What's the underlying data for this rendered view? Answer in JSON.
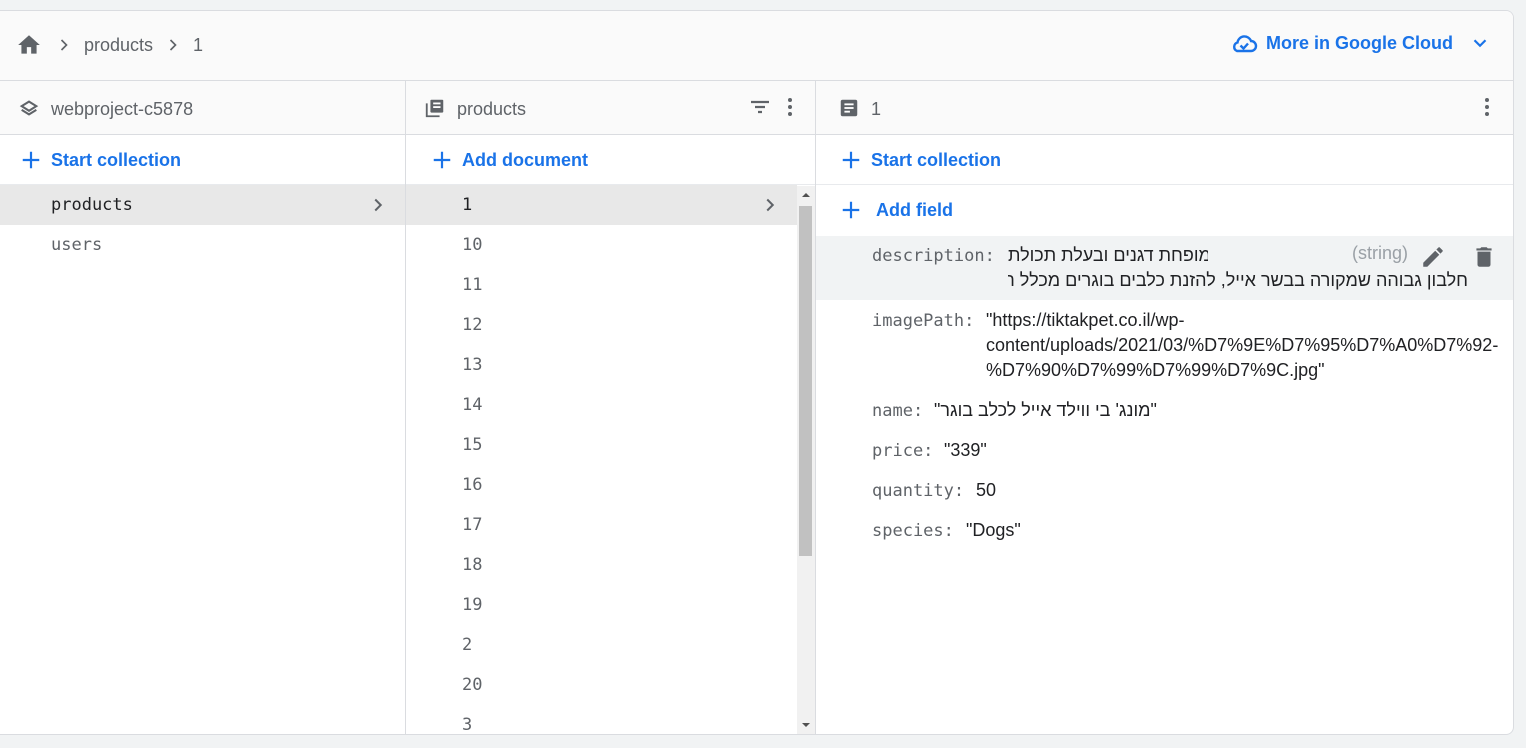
{
  "breadcrumb": {
    "items": [
      "products",
      "1"
    ]
  },
  "header": {
    "google_cloud_label": "More in Google Cloud"
  },
  "columns": {
    "project": {
      "title": "webproject-c5878",
      "action_label": "Start collection",
      "items": [
        {
          "label": "products",
          "selected": true
        },
        {
          "label": "users",
          "selected": false
        }
      ]
    },
    "collection": {
      "title": "products",
      "action_label": "Add document",
      "items": [
        "1",
        "10",
        "11",
        "12",
        "13",
        "14",
        "15",
        "16",
        "17",
        "18",
        "19",
        "2",
        "20",
        "3"
      ]
    },
    "document": {
      "title": "1",
      "action_label": "Start collection",
      "add_field_label": "Add field",
      "fields": [
        {
          "key": "description:",
          "value_line1": "\"דרת בי ווילד של מונג', מופחת דגנים ובעלת תכולת",
          "value_line2": "חלבון גבוהה שמקורה בבשר אייל, להזנת כלבים בוגרים מכלל הגזעים\"",
          "type": "(string)"
        },
        {
          "key": "imagePath:",
          "value_line1": "\"https://tiktakpet.co.il/wp-",
          "value_line2": "content/uploads/2021/03/%D7%9E%D7%95%D7%A0%D7%92-",
          "value_line3": "%D7%90%D7%99%D7%99%D7%9C.jpg\""
        },
        {
          "key": "name:",
          "value": "\"מונג' בי ווילד אייל לכלב בוגר\""
        },
        {
          "key": "price:",
          "value": "\"339\""
        },
        {
          "key": "quantity:",
          "value": "50"
        },
        {
          "key": "species:",
          "value": "\"Dogs\""
        }
      ]
    }
  },
  "colors": {
    "accent": "#1a73e8",
    "selected_row": "#e8e8e8",
    "text_secondary": "#5f6368"
  }
}
